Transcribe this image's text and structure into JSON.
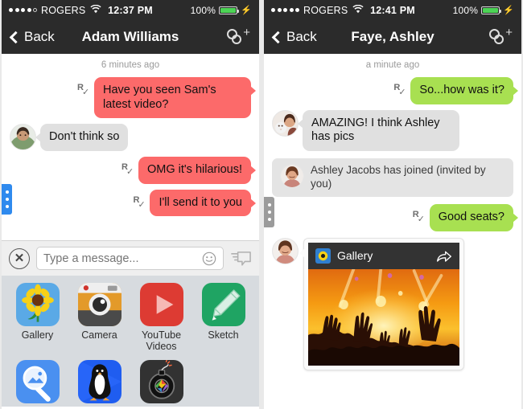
{
  "left_phone": {
    "status_bar": {
      "carrier": "ROGERS",
      "time": "12:37 PM",
      "battery_percent": "100%",
      "signal_filled": 4,
      "signal_total": 5,
      "wifi_icon": "wifi-icon",
      "charging_icon": "lightning-bolt-icon"
    },
    "nav": {
      "back_label": "Back",
      "title": "Adam Williams",
      "add_people_icon": "add-people-icon"
    },
    "thread": {
      "timestamp": "6 minutes ago",
      "messages": [
        {
          "id": "m1",
          "side": "out",
          "style": "pink",
          "text": "Have you seen Sam's latest video?",
          "receipt": "R"
        },
        {
          "id": "m2",
          "side": "in",
          "style": "grey",
          "text": "Don't think so",
          "avatar": "avatar-adam"
        },
        {
          "id": "m3",
          "side": "out",
          "style": "pink",
          "text": "OMG it's hilarious!",
          "receipt": "R"
        },
        {
          "id": "m4",
          "side": "out",
          "style": "pink",
          "text": "I'll send it to you",
          "receipt": "R"
        }
      ],
      "handle_color": "#2f8aee"
    },
    "composer": {
      "close_icon": "close-circle-icon",
      "placeholder": "Type a message...",
      "value": "",
      "emoji_icon": "smiley-icon",
      "keyboard_icon": "speech-bubble-icon"
    },
    "drawer": {
      "row1": [
        {
          "name": "gallery",
          "label": "Gallery",
          "icon": "sunflower-icon",
          "color": "#5aa9e6"
        },
        {
          "name": "camera",
          "label": "Camera",
          "icon": "camera-icon",
          "color": "#e39a2a"
        },
        {
          "name": "youtube-videos",
          "label": "YouTube Videos",
          "icon": "play-icon",
          "color": "#dd3b33"
        },
        {
          "name": "sketch",
          "label": "Sketch",
          "icon": "marker-icon",
          "color": "#1fa463"
        }
      ],
      "row2": [
        {
          "name": "image-search",
          "label": "",
          "icon": "magnifier-photo-icon",
          "color": "#4a90f0"
        },
        {
          "name": "penguin-app",
          "label": "",
          "icon": "penguin-icon",
          "color": "#1f5df0"
        },
        {
          "name": "bomb-camera",
          "label": "",
          "icon": "bomb-shutter-icon",
          "color": "#323232"
        }
      ]
    }
  },
  "right_phone": {
    "status_bar": {
      "carrier": "ROGERS",
      "time": "12:41 PM",
      "battery_percent": "100%",
      "signal_filled": 5,
      "signal_total": 5,
      "wifi_icon": "wifi-icon",
      "charging_icon": "lightning-bolt-icon"
    },
    "nav": {
      "back_label": "Back",
      "title": "Faye, Ashley",
      "add_people_icon": "add-people-icon"
    },
    "thread": {
      "timestamp": "a minute ago",
      "messages": [
        {
          "id": "r1",
          "side": "out",
          "style": "green",
          "text": "So...how was it?",
          "receipt": "R"
        },
        {
          "id": "r2",
          "side": "in",
          "style": "grey",
          "text": "AMAZING! I think Ashley has pics",
          "avatar": "avatar-faye"
        },
        {
          "id": "r3",
          "side": "system",
          "text": "Ashley Jacobs has joined (invited by you)",
          "avatar": "avatar-ashley"
        },
        {
          "id": "r4",
          "side": "out",
          "style": "green",
          "text": "Good seats?",
          "receipt": "R"
        }
      ],
      "handle_color": "#9b9b9b",
      "attachment_card": {
        "app_label": "Gallery",
        "app_icon": "sunflower-icon",
        "share_icon": "share-icon",
        "photo_alt": "concert-crowd-photo",
        "avatar": "avatar-ashley"
      }
    }
  }
}
